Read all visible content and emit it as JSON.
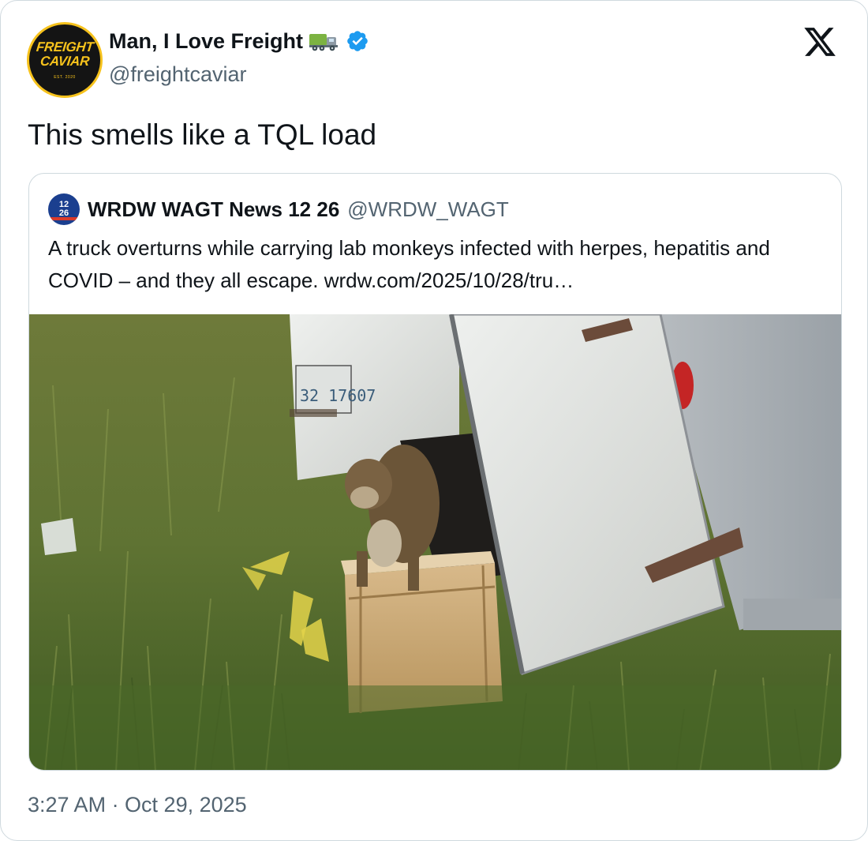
{
  "author": {
    "display_name": "Man, I Love Freight",
    "handle": "@freightcaviar",
    "avatar_text_line1": "FREIGHT",
    "avatar_text_line2": "CAVIAR",
    "avatar_text_est": "EST. 2020",
    "name_emoji": "truck-icon",
    "verified": true
  },
  "platform_logo": "x-logo-icon",
  "tweet": {
    "text": "This smells like a TQL load",
    "timestamp": "3:27 AM · Oct 29, 2025"
  },
  "quoted_tweet": {
    "author_name": "WRDW WAGT News 12 26",
    "author_handle": "@WRDW_WAGT",
    "avatar_text_line1": "12",
    "avatar_text_line2": "26",
    "text": "A truck overturns while carrying lab monkeys infected with herpes, hepatitis and COVID – and they all escape. wrdw.com/2025/10/28/tru…",
    "media": {
      "description_icon": "photo-icon",
      "trailer_marking": "32 17607"
    }
  },
  "colors": {
    "text_primary": "#0f1419",
    "text_secondary": "#536471",
    "border": "#cfd9de",
    "verified_blue": "#1d9bf0",
    "brand_yellow": "#f6c21c"
  }
}
